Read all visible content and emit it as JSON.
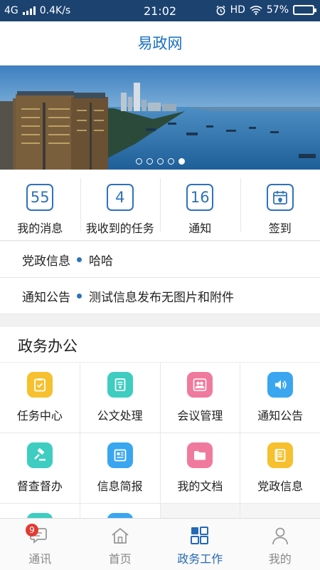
{
  "status_bar": {
    "network": "4G",
    "speed": "0.4K/s",
    "time": "21:02",
    "hd": "HD",
    "battery": "57%",
    "battery_level": 0.57
  },
  "header": {
    "title": "易政网"
  },
  "banner": {
    "slides": 5,
    "active_slide": 5
  },
  "stats": [
    {
      "value": "55",
      "label": "我的消息"
    },
    {
      "value": "4",
      "label": "我收到的任务"
    },
    {
      "value": "16",
      "label": "通知"
    },
    {
      "label": "签到",
      "icon": "calendar-checkin-icon"
    }
  ],
  "news": [
    {
      "category": "党政信息",
      "title": "哈哈"
    },
    {
      "category": "通知公告",
      "title": "测试信息发布无图片和附件"
    }
  ],
  "section": {
    "title": "政务办公"
  },
  "grid": [
    {
      "label": "任务中心",
      "icon": "clipboard-check-icon",
      "color": "#f6c02e"
    },
    {
      "label": "公文处理",
      "icon": "document-icon",
      "color": "#3ecdc0"
    },
    {
      "label": "会议管理",
      "icon": "people-icon",
      "color": "#f07a9e"
    },
    {
      "label": "通知公告",
      "icon": "speaker-icon",
      "color": "#3aa6f0"
    },
    {
      "label": "督查督办",
      "icon": "gavel-icon",
      "color": "#3ecdc0"
    },
    {
      "label": "信息简报",
      "icon": "newspaper-icon",
      "color": "#3aa6f0"
    },
    {
      "label": "我的文档",
      "icon": "folder-icon",
      "color": "#f07a9e"
    },
    {
      "label": "党政信息",
      "icon": "notebook-icon",
      "color": "#f6c02e"
    }
  ],
  "tabs": [
    {
      "label": "通讯",
      "icon": "chat-icon",
      "badge": "9"
    },
    {
      "label": "首页",
      "icon": "home-icon"
    },
    {
      "label": "政务工作",
      "icon": "grid-icon",
      "active": true
    },
    {
      "label": "我的",
      "icon": "person-icon"
    }
  ],
  "colors": {
    "accent": "#2f72b9",
    "title": "#1a6fc1",
    "status_bar": "#1c4370",
    "badge": "#e03b33"
  }
}
